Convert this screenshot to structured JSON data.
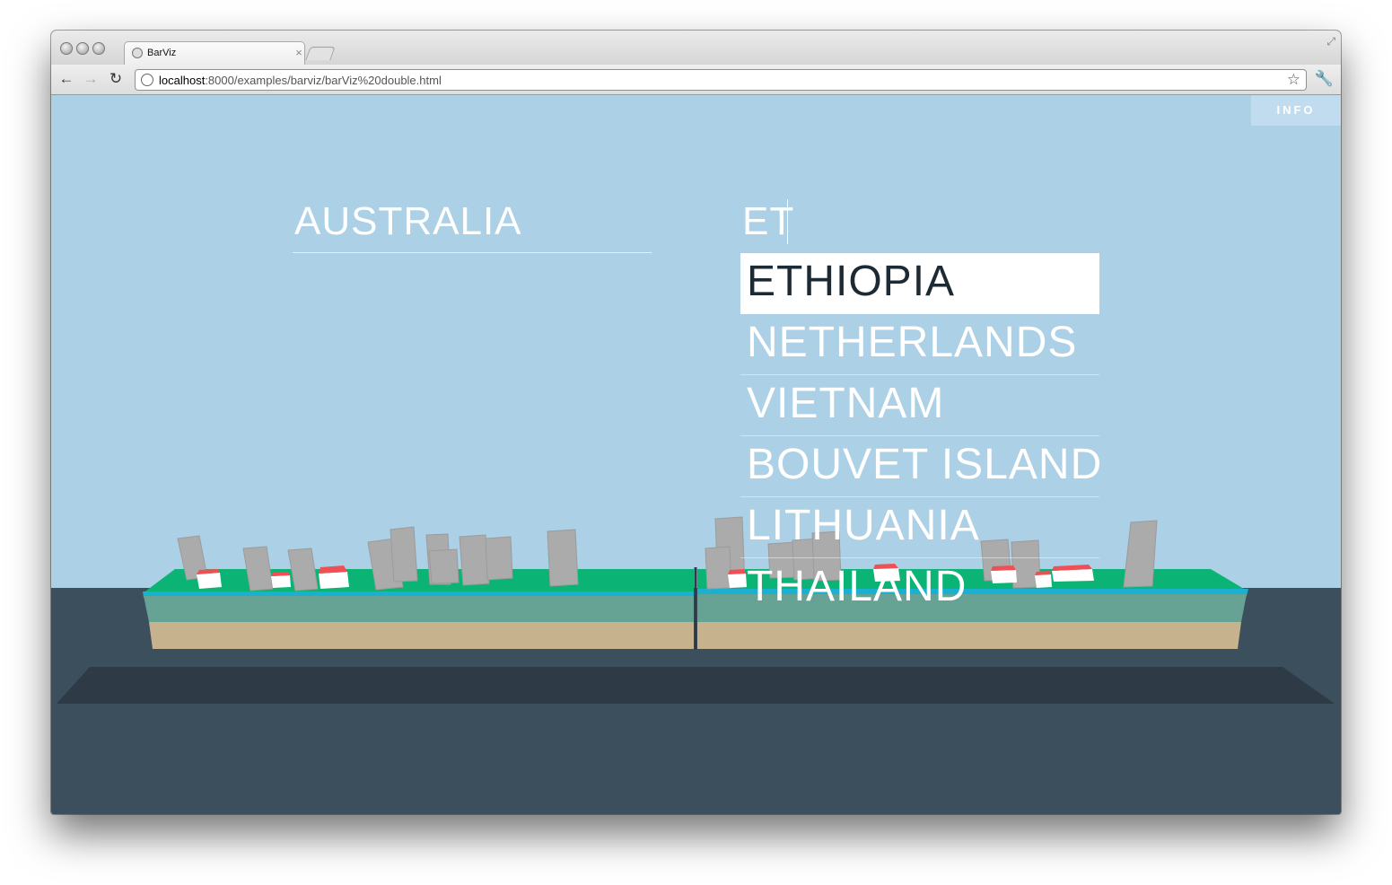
{
  "browser": {
    "tab_title": "BarViz",
    "url_host": "localhost",
    "url_rest": ":8000/examples/barviz/barViz%20double.html",
    "tab_close": "×"
  },
  "app": {
    "info_label": "INFO",
    "country_left": "AUSTRALIA",
    "country_right_input": "ET",
    "suggestions": [
      "ETHIOPIA",
      "NETHERLANDS",
      "VIETNAM",
      "BOUVET ISLAND",
      "LITHUANIA",
      "THAILAND"
    ],
    "selected_suggestion": "ETHIOPIA"
  },
  "colors": {
    "sky": "#acd0e5",
    "ground": "#3c4f5c",
    "grass": "#0bb474",
    "water": "#1ab0d0",
    "soil": "#66a394",
    "sand": "#c6b38e",
    "building": "#ababab",
    "house_roof": "#f05055"
  },
  "icons": [
    "back-icon",
    "forward-icon",
    "reload-icon",
    "globe-icon",
    "star-icon",
    "wrench-icon",
    "fullscreen-icon"
  ]
}
